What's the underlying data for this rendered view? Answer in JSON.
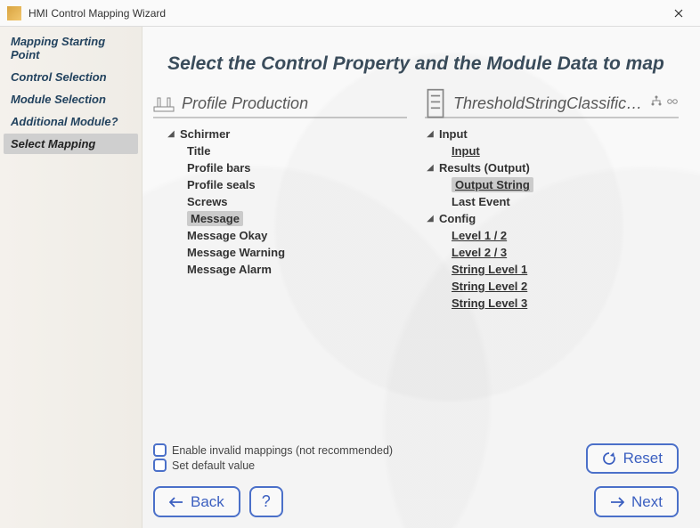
{
  "window": {
    "title": "HMI Control Mapping Wizard"
  },
  "sidebar": {
    "steps": [
      {
        "label": "Mapping Starting Point",
        "selected": false
      },
      {
        "label": "Control Selection",
        "selected": false
      },
      {
        "label": "Module Selection",
        "selected": false
      },
      {
        "label": "Additional Module?",
        "selected": false
      },
      {
        "label": "Select Mapping",
        "selected": true
      }
    ]
  },
  "main": {
    "heading": "Select the Control Property and the Module Data to map",
    "left_panel": {
      "title": "Profile Production",
      "root_label": "Schirmer",
      "items": [
        {
          "label": "Title",
          "selected": false
        },
        {
          "label": "Profile bars",
          "selected": false
        },
        {
          "label": "Profile seals",
          "selected": false
        },
        {
          "label": "Screws",
          "selected": false
        },
        {
          "label": "Message",
          "selected": true
        },
        {
          "label": "Message Okay",
          "selected": false
        },
        {
          "label": "Message Warning",
          "selected": false
        },
        {
          "label": "Message Alarm",
          "selected": false
        }
      ]
    },
    "right_panel": {
      "title": "ThresholdStringClassificat…",
      "sections": [
        {
          "label": "Input",
          "items": [
            {
              "label": "Input",
              "link": true,
              "selected": false
            }
          ]
        },
        {
          "label": "Results (Output)",
          "items": [
            {
              "label": "Output String",
              "link": true,
              "selected": true
            },
            {
              "label": "Last Event",
              "link": false,
              "selected": false
            }
          ]
        },
        {
          "label": "Config",
          "items": [
            {
              "label": "Level 1 / 2",
              "link": true,
              "selected": false
            },
            {
              "label": "Level 2 / 3",
              "link": true,
              "selected": false
            },
            {
              "label": "String Level 1",
              "link": true,
              "selected": false
            },
            {
              "label": "String Level 2",
              "link": true,
              "selected": false
            },
            {
              "label": "String Level 3",
              "link": true,
              "selected": false
            }
          ]
        }
      ]
    },
    "options": {
      "invalid_mappings": "Enable invalid mappings (not recommended)",
      "set_default": "Set default value"
    },
    "buttons": {
      "reset": "Reset",
      "back": "Back",
      "help": "?",
      "next": "Next"
    }
  }
}
